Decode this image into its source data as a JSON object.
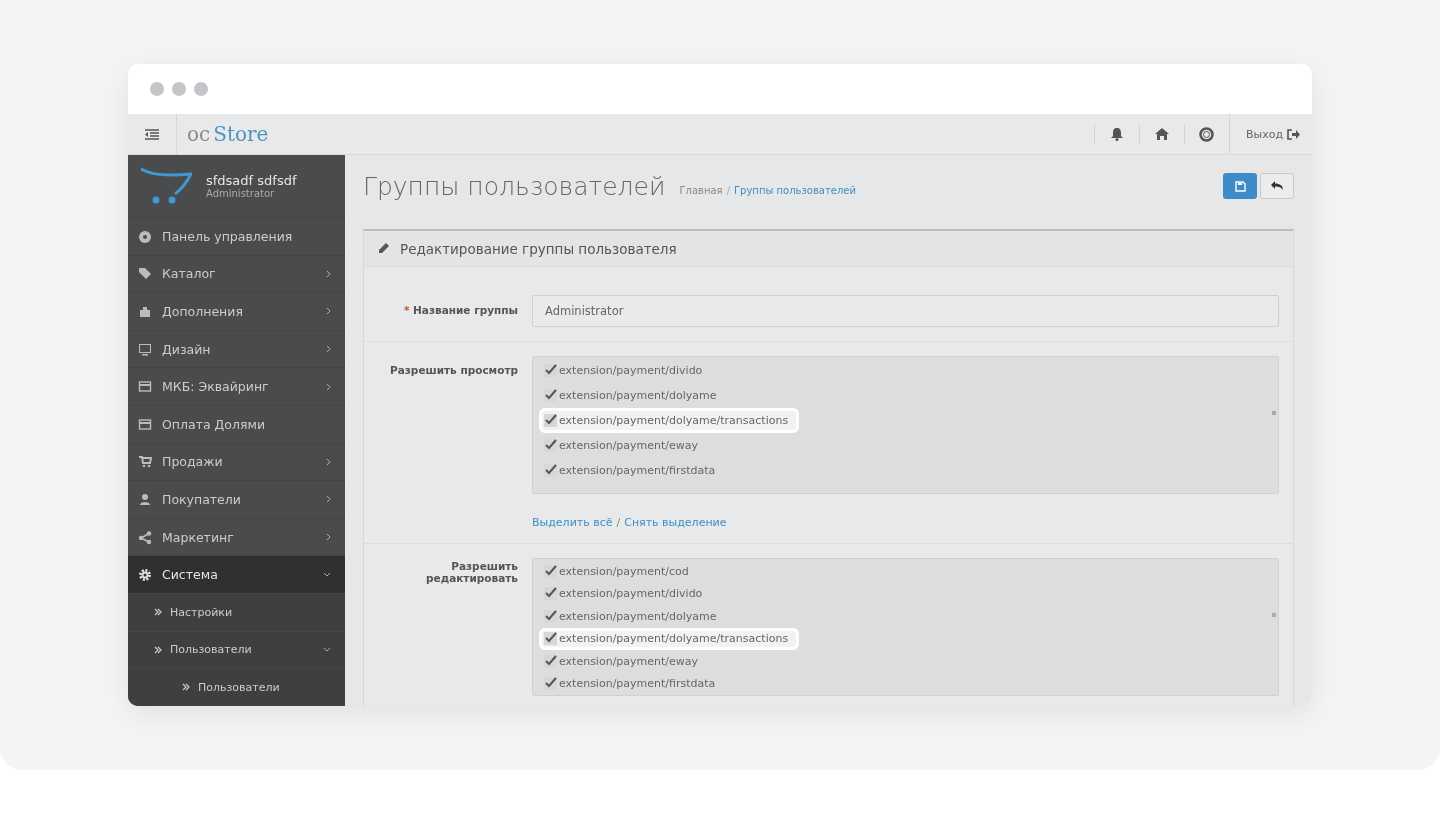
{
  "header": {
    "logo_prefix": "oc",
    "logo_main": "Store",
    "logout": "Выход"
  },
  "user": {
    "name": "sfdsadf sdfsdf",
    "role": "Administrator"
  },
  "sidebar": {
    "items": [
      {
        "label": "Панель управления",
        "submenu": false,
        "selected": false
      },
      {
        "label": "Каталог",
        "submenu": true,
        "expanded": false,
        "selected": false
      },
      {
        "label": "Дополнения",
        "submenu": true,
        "expanded": false,
        "selected": false
      },
      {
        "label": "Дизайн",
        "submenu": true,
        "expanded": false,
        "selected": false
      },
      {
        "label": "МКБ: Эквайринг",
        "submenu": true,
        "expanded": false,
        "selected": false
      },
      {
        "label": "Оплата Долями",
        "submenu": false,
        "selected": false
      },
      {
        "label": "Продажи",
        "submenu": true,
        "expanded": false,
        "selected": false
      },
      {
        "label": "Покупатели",
        "submenu": true,
        "expanded": false,
        "selected": false
      },
      {
        "label": "Маркетинг",
        "submenu": true,
        "expanded": false,
        "selected": false
      },
      {
        "label": "Система",
        "submenu": true,
        "expanded": true,
        "selected": true,
        "children": [
          {
            "label": "Настройки",
            "submenu": false,
            "selected": false
          },
          {
            "label": "Пользователи",
            "submenu": true,
            "expanded": true,
            "selected": false,
            "children": [
              {
                "label": "Пользователи",
                "submenu": false,
                "selected": false
              }
            ]
          }
        ]
      }
    ]
  },
  "page": {
    "title": "Группы пользователей",
    "breadcrumbs": [
      "Главная",
      "Группы пользователей"
    ],
    "breadcrumb_separator": "/"
  },
  "panel": {
    "title": "Редактирование группы пользователя",
    "name_field": {
      "label": "Название группы",
      "required": true,
      "required_mark": "*",
      "value": "Administrator"
    },
    "permissions": [
      {
        "label": "Разрешить просмотр",
        "items": [
          {
            "path": "extension/payment/divido",
            "checked": true,
            "highlighted": false
          },
          {
            "path": "extension/payment/dolyame",
            "checked": true,
            "highlighted": false
          },
          {
            "path": "extension/payment/dolyame/transactions",
            "checked": true,
            "highlighted": true
          },
          {
            "path": "extension/payment/eway",
            "checked": true,
            "highlighted": false
          },
          {
            "path": "extension/payment/firstdata",
            "checked": true,
            "highlighted": false
          }
        ],
        "links": [
          "Выделить всё",
          "Снять выделение"
        ],
        "link_separator": "/"
      },
      {
        "label": "Разрешить редактировать",
        "items": [
          {
            "path": "extension/payment/cod",
            "checked": true,
            "highlighted": false
          },
          {
            "path": "extension/payment/divido",
            "checked": true,
            "highlighted": false
          },
          {
            "path": "extension/payment/dolyame",
            "checked": true,
            "highlighted": false
          },
          {
            "path": "extension/payment/dolyame/transactions",
            "checked": true,
            "highlighted": true
          },
          {
            "path": "extension/payment/eway",
            "checked": true,
            "highlighted": false
          },
          {
            "path": "extension/payment/firstdata",
            "checked": true,
            "highlighted": false
          }
        ]
      }
    ]
  }
}
